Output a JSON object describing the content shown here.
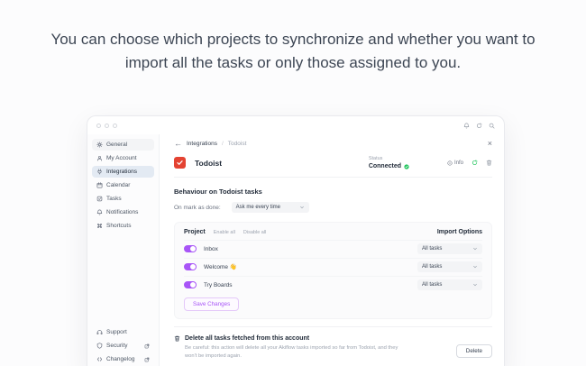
{
  "headline": "You can choose which projects to synchronize and whether you want to import all the tasks or only those assigned to you.",
  "breadcrumb": {
    "parent": "Integrations",
    "separator": "/",
    "current": "Todoist"
  },
  "sidebar": {
    "items": [
      {
        "label": "General",
        "icon": "gear-icon"
      },
      {
        "label": "My Account",
        "icon": "user-icon"
      },
      {
        "label": "Integrations",
        "icon": "plug-icon",
        "selected": true
      },
      {
        "label": "Calendar",
        "icon": "calendar-icon"
      },
      {
        "label": "Tasks",
        "icon": "check-square-icon"
      },
      {
        "label": "Notifications",
        "icon": "bell-icon"
      },
      {
        "label": "Shortcuts",
        "icon": "command-icon"
      }
    ],
    "footer_items": [
      {
        "label": "Support",
        "icon": "headset-icon",
        "external": false
      },
      {
        "label": "Security",
        "icon": "shield-icon",
        "external": true
      },
      {
        "label": "Changelog",
        "icon": "code-icon",
        "external": true
      }
    ]
  },
  "header": {
    "app_name": "Todoist",
    "status_label": "Status",
    "status_value": "Connected",
    "info_label": "Info"
  },
  "behaviour": {
    "title": "Behaviour on Todoist tasks",
    "on_mark_label": "On mark as done:",
    "dropdown_value": "Ask me every time"
  },
  "projects": {
    "header": "Project",
    "enable_all": "Enable all",
    "disable_all": "Disable all",
    "import_options_header": "Import Options",
    "rows": [
      {
        "name": "Inbox",
        "enabled": true,
        "import_option": "All tasks"
      },
      {
        "name": "Welcome 👋",
        "enabled": true,
        "import_option": "All tasks"
      },
      {
        "name": "Try Boards",
        "enabled": true,
        "import_option": "All tasks"
      }
    ],
    "save_button": "Save Changes"
  },
  "danger": {
    "title": "Delete all tasks fetched from this account",
    "description": "Be careful: this action will delete all your Akiflow tasks imported so far from Todoist, and they won't be imported again.",
    "delete_button": "Delete"
  },
  "icons_topbar": [
    "bell-icon",
    "refresh-icon",
    "search-icon"
  ],
  "colors": {
    "accent_purple": "#a855f7",
    "success_green": "#22c55e",
    "todoist_red": "#e44332",
    "selected_item_bg": "#e3eaf3"
  }
}
